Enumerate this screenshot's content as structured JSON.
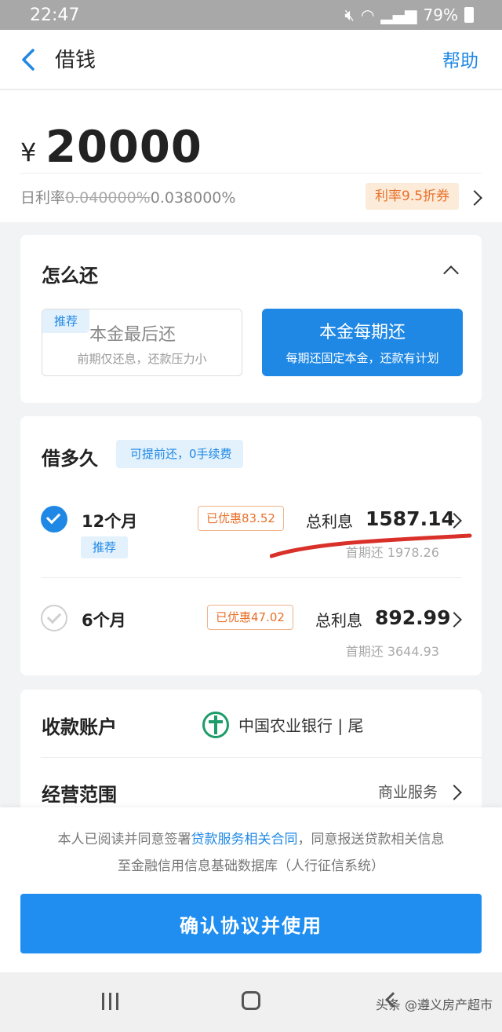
{
  "status_bar": {
    "time": "22:47",
    "battery": "79%"
  },
  "nav": {
    "title": "借钱",
    "help": "帮助"
  },
  "amount": {
    "currency": "¥",
    "value": "20000",
    "rate_label": "日利率",
    "rate_old": "0.040000%",
    "rate_new": "0.038000%",
    "rate_badge": "利率9.5折券"
  },
  "repay": {
    "title": "怎么还",
    "option_interest_first": {
      "tag": "推荐",
      "title": "本金最后还",
      "subtitle": "前期仅还息，还款压力小"
    },
    "option_principal_each": {
      "title": "本金每期还",
      "subtitle": "每期还固定本金，还款有计划"
    }
  },
  "term": {
    "title": "借多久",
    "tag": "可提前还，0手续费",
    "options": [
      {
        "label": "12个月",
        "recommend": "推荐",
        "discount": "已优惠83.52",
        "total_interest_label": "总利息",
        "total_interest": "1587.14",
        "first_payment": "首期还 1978.26",
        "selected": true
      },
      {
        "label": "6个月",
        "discount": "已优惠47.02",
        "total_interest_label": "总利息",
        "total_interest": "892.99",
        "first_payment": "首期还 3644.93",
        "selected": false
      }
    ]
  },
  "account": {
    "title": "收款账户",
    "bank_name": "中国农业银行 | 尾",
    "scope_title": "经营范围",
    "scope_value": "商业服务"
  },
  "agreement": {
    "line1_pre": "本人已阅读并同意签署",
    "line1_link": "贷款服务相关合同",
    "line1_post": "，同意报送贷款相关信息",
    "line2": "至金融信用信息基础数据库（人行征信系统）",
    "confirm_button": "确认协议并使用"
  },
  "watermark": "头条 @遵义房产超市",
  "colors": {
    "accent": "#1f88e5",
    "discount": "#e8702a",
    "underline": "#d9302a"
  }
}
